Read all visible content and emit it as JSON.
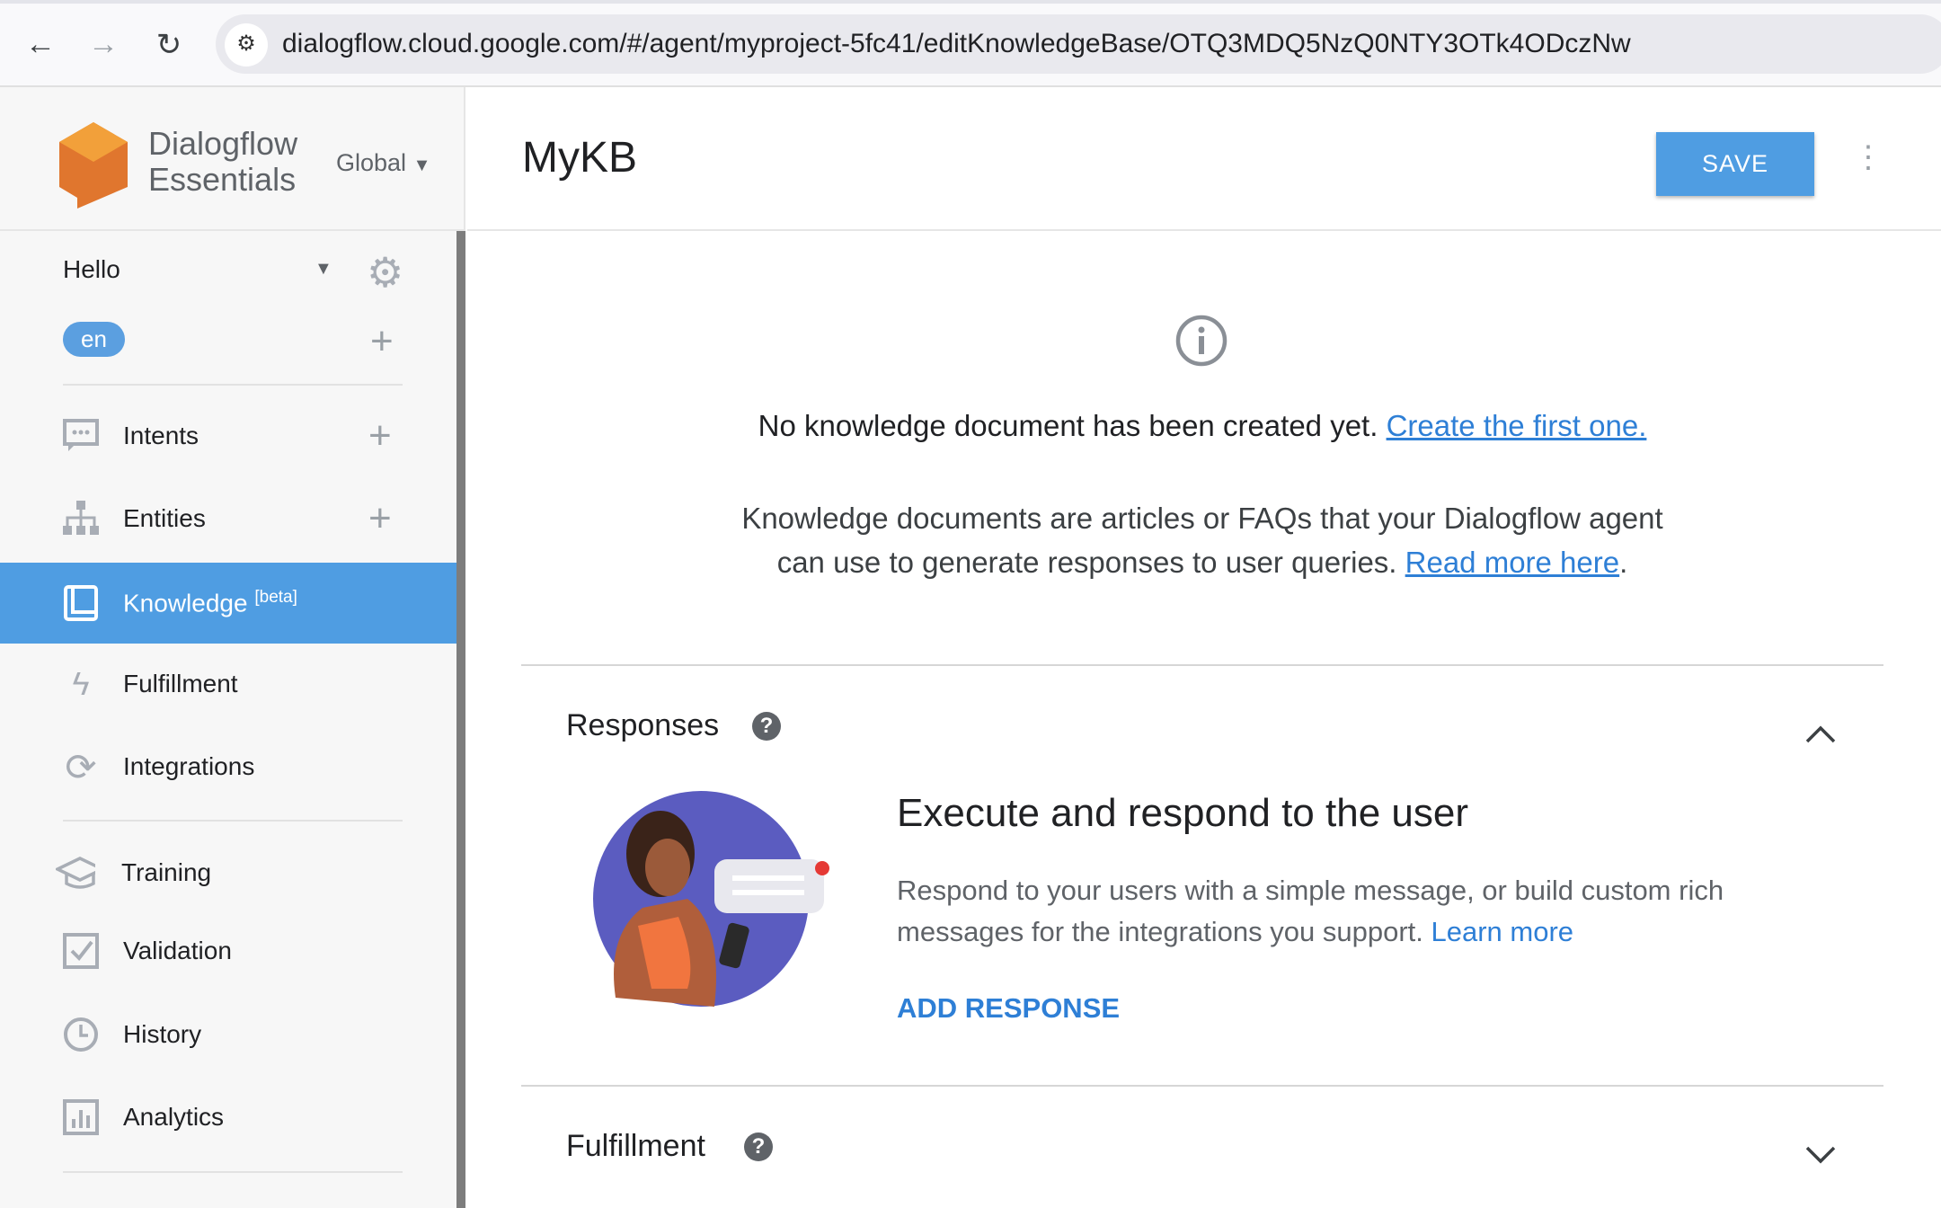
{
  "browser": {
    "url": "dialogflow.cloud.google.com/#/agent/myproject-5fc41/editKnowledgeBase/OTQ3MDQ5NzQ0NTY3OTk4ODczNw"
  },
  "brand": {
    "line1": "Dialogflow",
    "line2": "Essentials",
    "region": "Global"
  },
  "agent": {
    "name": "Hello",
    "language": "en"
  },
  "sidebar": {
    "items": [
      {
        "label": "Intents"
      },
      {
        "label": "Entities"
      },
      {
        "label": "Knowledge",
        "sup": "[beta]"
      },
      {
        "label": "Fulfillment"
      },
      {
        "label": "Integrations"
      },
      {
        "label": "Training"
      },
      {
        "label": "Validation"
      },
      {
        "label": "History"
      },
      {
        "label": "Analytics"
      }
    ]
  },
  "header": {
    "title": "MyKB",
    "save_label": "SAVE"
  },
  "empty": {
    "message": "No knowledge document has been created yet.",
    "create_link": "Create the first one.",
    "desc1": "Knowledge documents are articles or FAQs that your Dialogflow agent",
    "desc2": "can use to generate responses to user queries.",
    "read_more": "Read more here",
    "period": "."
  },
  "responses": {
    "title": "Responses",
    "heading": "Execute and respond to the user",
    "desc1": "Respond to your users with a simple message, or build custom rich",
    "desc2": "messages for the integrations you support.",
    "learn_more": "Learn more",
    "add": "ADD RESPONSE"
  },
  "fulfillment": {
    "title": "Fulfillment"
  },
  "colors": {
    "accent": "#4f9de2",
    "link": "#2e7fd6"
  }
}
